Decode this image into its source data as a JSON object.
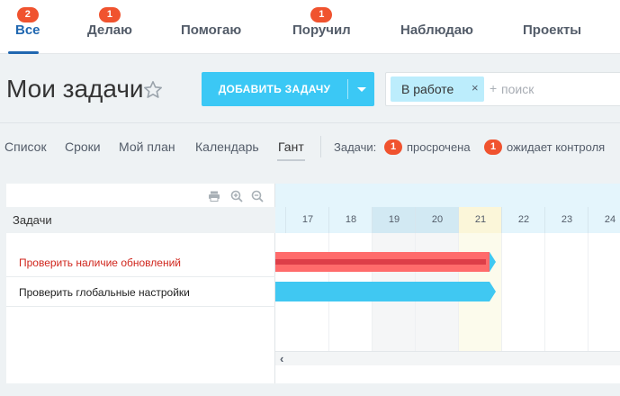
{
  "top_tabs": [
    {
      "label": "Все",
      "counter": "2",
      "active": true
    },
    {
      "label": "Делаю",
      "counter": "1",
      "active": false
    },
    {
      "label": "Помогаю",
      "counter": "",
      "active": false
    },
    {
      "label": "Поручил",
      "counter": "1",
      "active": false
    },
    {
      "label": "Наблюдаю",
      "counter": "",
      "active": false
    },
    {
      "label": "Проекты",
      "counter": "",
      "active": false
    }
  ],
  "header": {
    "title": "Мои задачи",
    "add_button_label": "ДОБАВИТЬ ЗАДАЧУ",
    "filter_tag": "В работе",
    "filter_tag_remove": "×",
    "search_plus": "+",
    "search_placeholder": "поиск"
  },
  "view_tabs": [
    {
      "label": "Список",
      "active": false
    },
    {
      "label": "Сроки",
      "active": false
    },
    {
      "label": "Мой план",
      "active": false
    },
    {
      "label": "Календарь",
      "active": false
    },
    {
      "label": "Гант",
      "active": true
    }
  ],
  "task_summary": {
    "label": "Задачи:",
    "overdue_count": "1",
    "overdue_label": "просрочена",
    "awaiting_count": "1",
    "awaiting_label": "ожидает контроля"
  },
  "gantt": {
    "column_header": "Задачи",
    "days": [
      {
        "day": "17",
        "kind": "normal"
      },
      {
        "day": "18",
        "kind": "normal"
      },
      {
        "day": "19",
        "kind": "weekend"
      },
      {
        "day": "20",
        "kind": "weekend"
      },
      {
        "day": "21",
        "kind": "today"
      },
      {
        "day": "22",
        "kind": "normal"
      },
      {
        "day": "23",
        "kind": "normal"
      },
      {
        "day": "24",
        "kind": "normal"
      }
    ],
    "tasks": [
      {
        "name": "Проверить наличие обновлений",
        "status": "overdue",
        "bar_color": "#ff6b6b",
        "end_day": "21"
      },
      {
        "name": "Проверить глобальные настройки",
        "status": "normal",
        "bar_color": "#40c8f2",
        "end_day": "21"
      }
    ],
    "scroll_left_glyph": "‹"
  },
  "colors": {
    "accent_blue": "#2067b0",
    "button_cyan": "#3bc8f5",
    "badge_red": "#f0532f",
    "overdue_text": "#d0261d"
  }
}
